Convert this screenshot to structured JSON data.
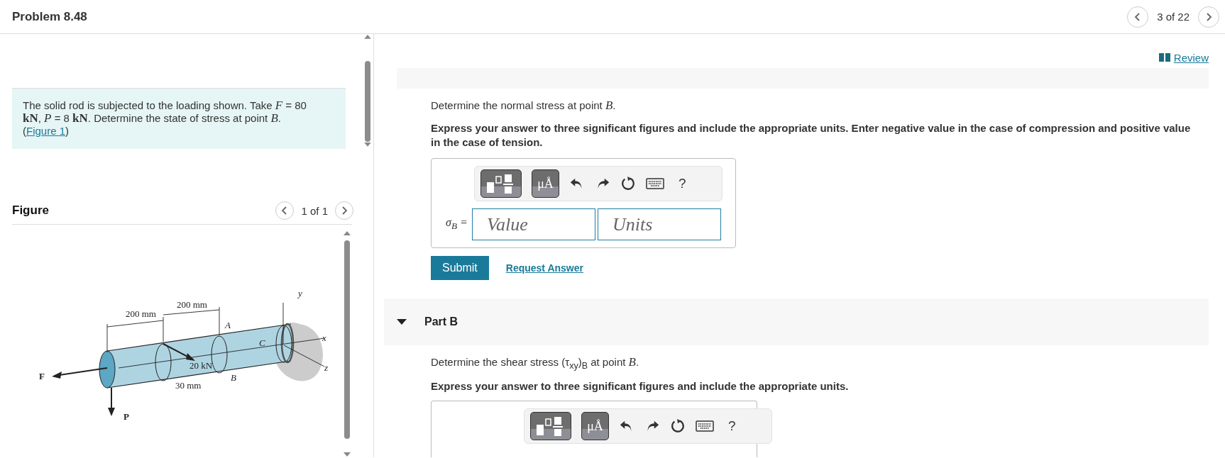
{
  "header": {
    "title": "Problem 8.48",
    "pager": "3 of 22"
  },
  "problem": {
    "text": "The solid rod is subjected to the loading shown. Take *F* = 80 **kN**, *P* = 8 **kN**. Determine the state of stress at point *B*. (",
    "link": "Figure 1",
    "text_end": ")"
  },
  "figure": {
    "heading": "Figure",
    "pager": "1 of 1",
    "labels": [
      "200 mm",
      "200 mm",
      "A",
      "C",
      "y",
      "x",
      "z",
      "20 kN",
      "B",
      "30 mm",
      "F",
      "P"
    ]
  },
  "review": "Review",
  "part_a": {
    "question": "Determine the normal stress at point *B*.",
    "instructions": "Express your answer to three significant figures and include the appropriate units. Enter negative value in the case of compression and positive value in the case of tension.",
    "toolbar": {
      "units": "μÅ",
      "help": "?"
    },
    "label": "σ$_{B}$ =",
    "value_placeholder": "Value",
    "units_placeholder": "Units",
    "submit": "Submit",
    "request": "Request Answer"
  },
  "part_b": {
    "title": "Part B",
    "expanded": true,
    "question": "Determine the shear stress (τ$_{xy}$)$_{B}$ at point *B*.",
    "instructions": "Express your answer to three significant figures and include the appropriate units.",
    "toolbar": {
      "units": "μÅ",
      "help": "?"
    }
  }
}
